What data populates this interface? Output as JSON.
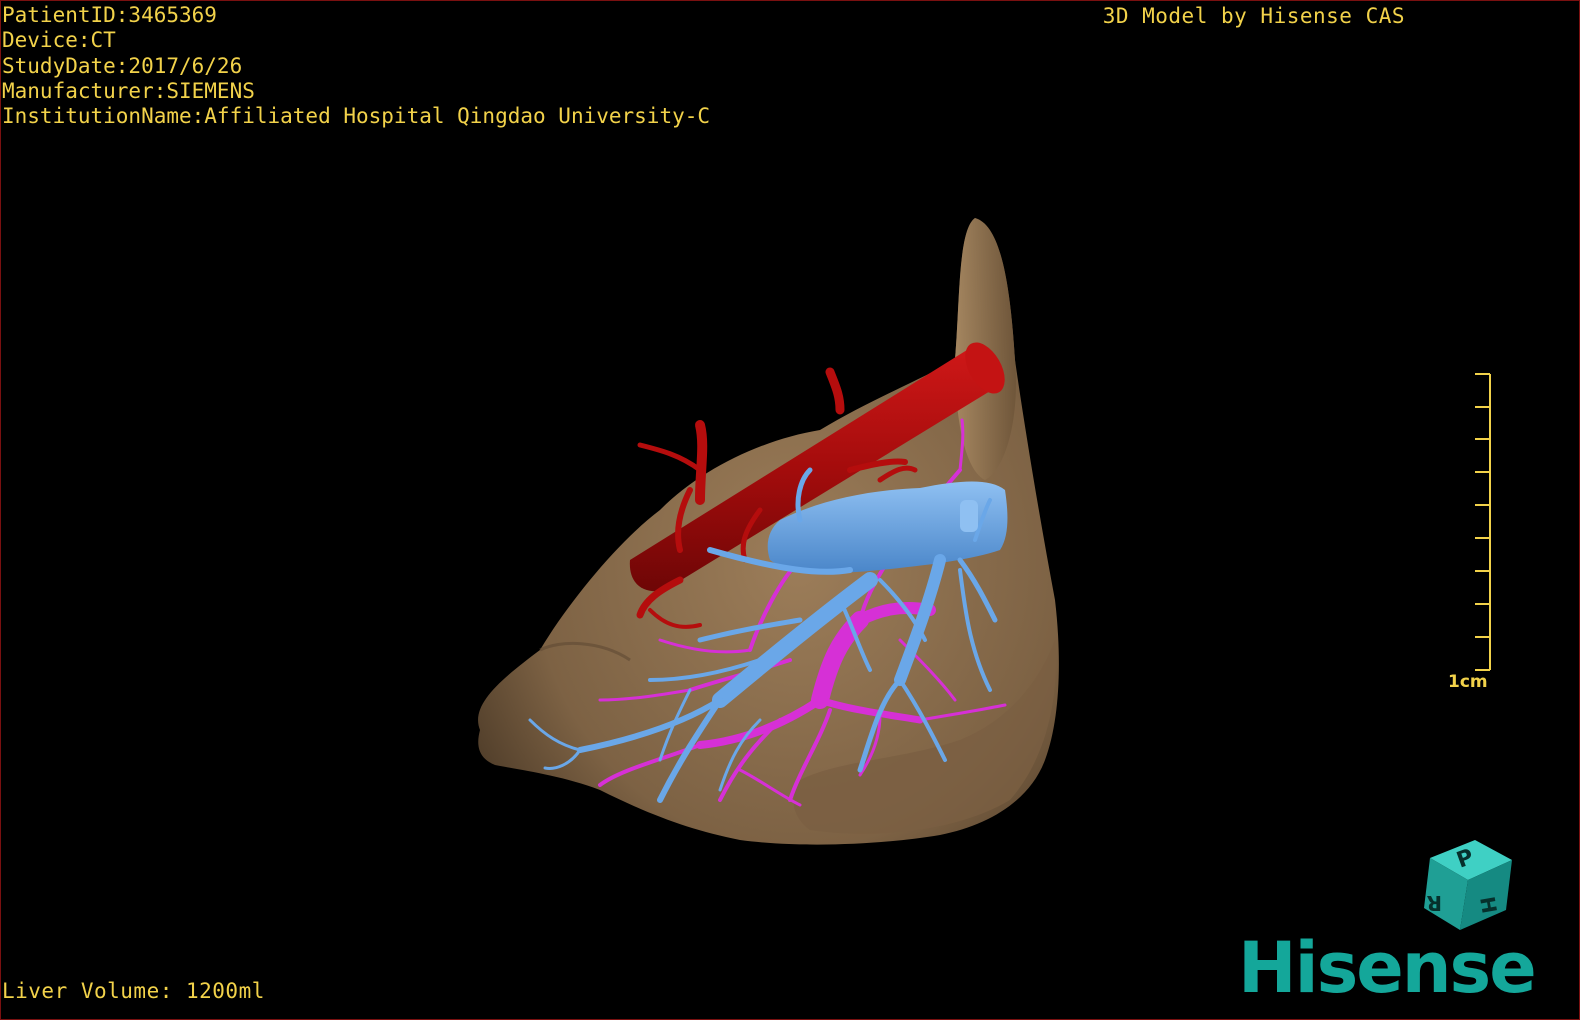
{
  "info": {
    "patient_id": "PatientID:3465369",
    "device": "Device:CT",
    "study_date": "StudyDate:2017/6/26",
    "manufacturer": "Manufacturer:SIEMENS",
    "institution": "InstitutionName:Affiliated Hospital Qingdao University-C"
  },
  "credit": "3D Model by Hisense CAS",
  "volume": "Liver Volume: 1200ml",
  "scale_bar": {
    "label": "1cm"
  },
  "orientation_cube": {
    "faces": [
      "P",
      "H",
      "R"
    ]
  },
  "brand": "Hisense",
  "colors": {
    "overlay_text": "#f2d24a",
    "liver": "#8c6f4f",
    "artery": "#b50d0d",
    "portal_vein": "#d630d6",
    "hepatic_vein": "#6aa7e8",
    "brand": "#14a79a"
  }
}
